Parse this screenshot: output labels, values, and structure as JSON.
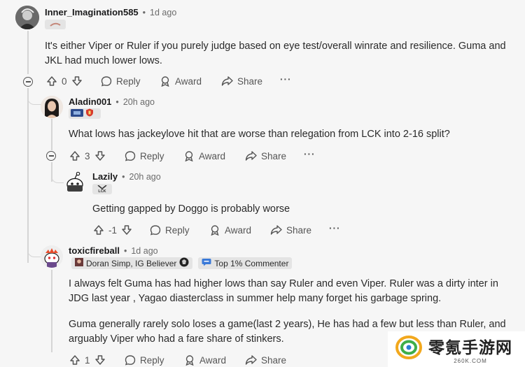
{
  "comments": [
    {
      "username": "Inner_Imagination585",
      "time": "1d ago",
      "text": "It's either Viper or Ruler if you purely judge based on eye test/overall winrate and resilience. Guma and JKL had much lower lows.",
      "votes": "0"
    },
    {
      "username": "Aladin001",
      "time": "20h ago",
      "text": "What lows has jackeylove hit that are worse than relegation from LCK into 2-16 split?",
      "votes": "3"
    },
    {
      "username": "Lazily",
      "time": "20h ago",
      "flair_icon_text": "LCK",
      "text": "Getting gapped by Doggo is probably worse",
      "votes": "-1"
    },
    {
      "username": "toxicfireball",
      "time": "1d ago",
      "flair1": "Doran Simp, IG Believer",
      "flair2": "Top 1% Commenter",
      "text1": "I always felt Guma has had higher lows than say Ruler and even Viper. Ruler was a dirty inter in JDG last year , Yagao diasterclass in summer help many forget his garbage spring.",
      "text2": "Guma generally rarely solo loses a game(last 2 years), He has had a few but less than Ruler, and arguably Viper who had a fare share of stinkers.",
      "votes": "1"
    }
  ],
  "actions": {
    "reply": "Reply",
    "award": "Award",
    "share": "Share",
    "more": "···"
  },
  "separator": "•",
  "watermark": {
    "title": "零氪手游网",
    "subtitle": "260K.COM"
  }
}
